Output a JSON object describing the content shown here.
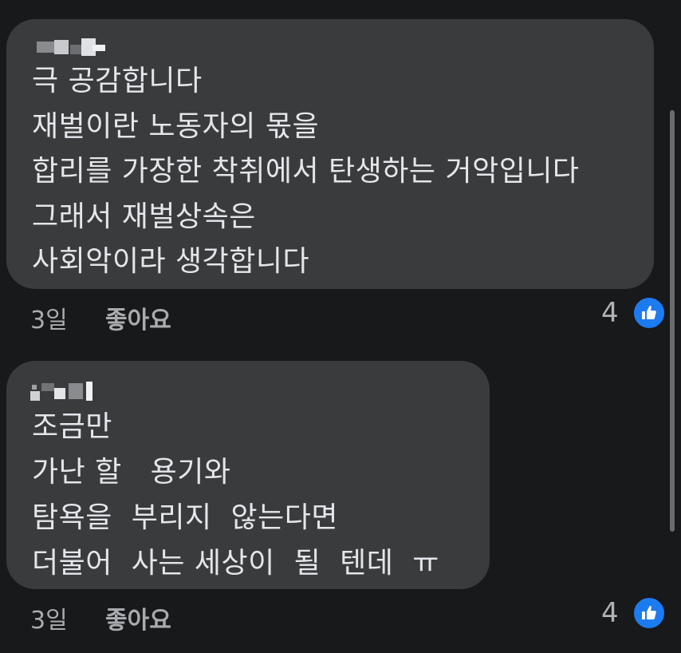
{
  "comments": [
    {
      "text_lines": [
        "극 공감합니다",
        "재벌이란 노동자의 몫을",
        "합리를 가장한 착취에서 탄생하는 거악입니다",
        "그래서 재벌상속은",
        "사회악이라 생각합니다"
      ],
      "time": "3일",
      "like_label": "좋아요",
      "reaction_count": "4"
    },
    {
      "text_lines": [
        "조금만",
        "가난 할   용기와",
        "탐욕을  부리지  않는다면",
        "더불어  사는 세상이  될  텐데  ㅠ"
      ],
      "time": "3일",
      "like_label": "좋아요",
      "reaction_count": "4"
    }
  ],
  "icons": {
    "like_reaction": "thumbs-up-icon"
  },
  "colors": {
    "background": "#18191b",
    "bubble": "#3a3b3c",
    "text": "#e4e6eb",
    "meta_text": "#a9abaf",
    "like_badge": "#1d7bf0"
  }
}
